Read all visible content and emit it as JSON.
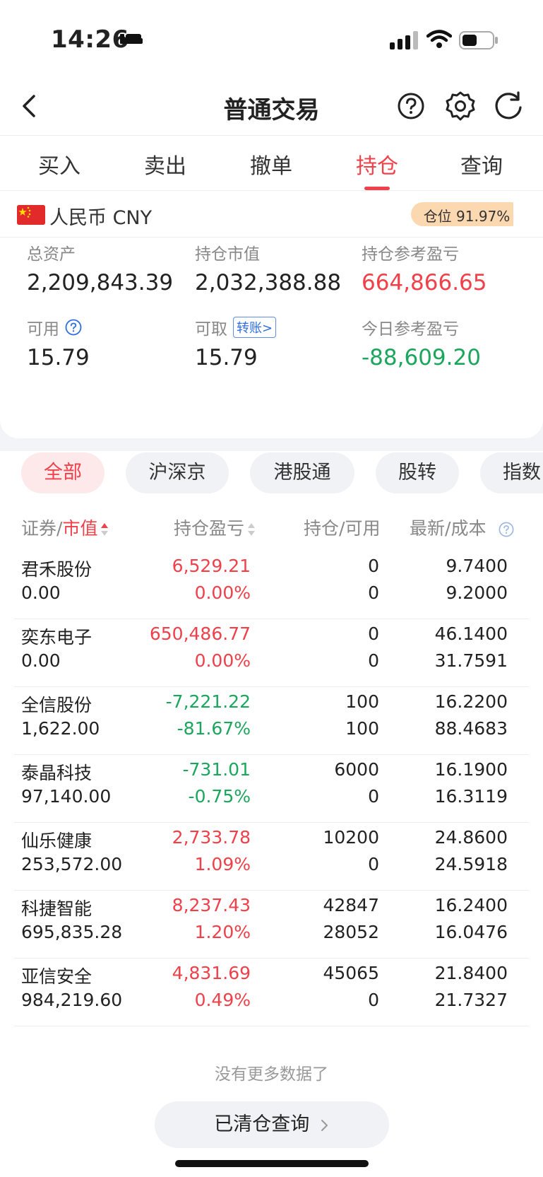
{
  "status": {
    "time": "14:26"
  },
  "nav": {
    "title": "普通交易"
  },
  "tabs": [
    {
      "label": "买入",
      "active": false
    },
    {
      "label": "卖出",
      "active": false
    },
    {
      "label": "撤单",
      "active": false
    },
    {
      "label": "持仓",
      "active": true
    },
    {
      "label": "查询",
      "active": false
    }
  ],
  "currency": {
    "label": "人民币 CNY",
    "position_text": "仓位 91.97%",
    "position_fraction": 0.9197
  },
  "summary": {
    "total_assets_label": "总资产",
    "total_assets": "2,209,843.39",
    "market_value_label": "持仓市值",
    "market_value": "2,032,388.88",
    "holding_pl_label": "持仓参考盈亏",
    "holding_pl": "664,866.65",
    "available_label": "可用",
    "available": "15.79",
    "withdrawable_label": "可取",
    "transfer_label": "转账>",
    "withdrawable": "15.79",
    "today_pl_label": "今日参考盈亏",
    "today_pl": "-88,609.20"
  },
  "filters": [
    {
      "label": "全部",
      "active": true
    },
    {
      "label": "沪深京",
      "active": false
    },
    {
      "label": "港股通",
      "active": false
    },
    {
      "label": "股转",
      "active": false
    },
    {
      "label": "指数",
      "active": false
    }
  ],
  "table": {
    "headers": {
      "security": "证券",
      "sep1": "/",
      "market_value": "市值",
      "pl": "持仓盈亏",
      "hold": "持仓",
      "sep2": "/",
      "avail": "可用",
      "latest": "最新",
      "sep3": "/",
      "cost": "成本"
    },
    "rows": [
      {
        "name": "君禾股份",
        "mv": "0.00",
        "pl": "6,529.21",
        "plp": "0.00%",
        "hold": "0",
        "avail": "0",
        "latest": "9.7400",
        "cost": "9.2000",
        "trend": "up"
      },
      {
        "name": "奕东电子",
        "mv": "0.00",
        "pl": "650,486.77",
        "plp": "0.00%",
        "hold": "0",
        "avail": "0",
        "latest": "46.1400",
        "cost": "31.7591",
        "trend": "up"
      },
      {
        "name": "全信股份",
        "mv": "1,622.00",
        "pl": "-7,221.22",
        "plp": "-81.67%",
        "hold": "100",
        "avail": "100",
        "latest": "16.2200",
        "cost": "88.4683",
        "trend": "down"
      },
      {
        "name": "泰晶科技",
        "mv": "97,140.00",
        "pl": "-731.01",
        "plp": "-0.75%",
        "hold": "6000",
        "avail": "0",
        "latest": "16.1900",
        "cost": "16.3119",
        "trend": "down"
      },
      {
        "name": "仙乐健康",
        "mv": "253,572.00",
        "pl": "2,733.78",
        "plp": "1.09%",
        "hold": "10200",
        "avail": "0",
        "latest": "24.8600",
        "cost": "24.5918",
        "trend": "up"
      },
      {
        "name": "科捷智能",
        "mv": "695,835.28",
        "pl": "8,237.43",
        "plp": "1.20%",
        "hold": "42847",
        "avail": "28052",
        "latest": "16.2400",
        "cost": "16.0476",
        "trend": "up"
      },
      {
        "name": "亚信安全",
        "mv": "984,219.60",
        "pl": "4,831.69",
        "plp": "0.49%",
        "hold": "45065",
        "avail": "0",
        "latest": "21.8400",
        "cost": "21.7327",
        "trend": "up"
      }
    ]
  },
  "footer": {
    "no_more": "没有更多数据了",
    "cleared_button": "已清仓查询"
  },
  "colors": {
    "red": "#f0404a",
    "green": "#1aa75d",
    "accent_blue": "#2f6de0"
  }
}
